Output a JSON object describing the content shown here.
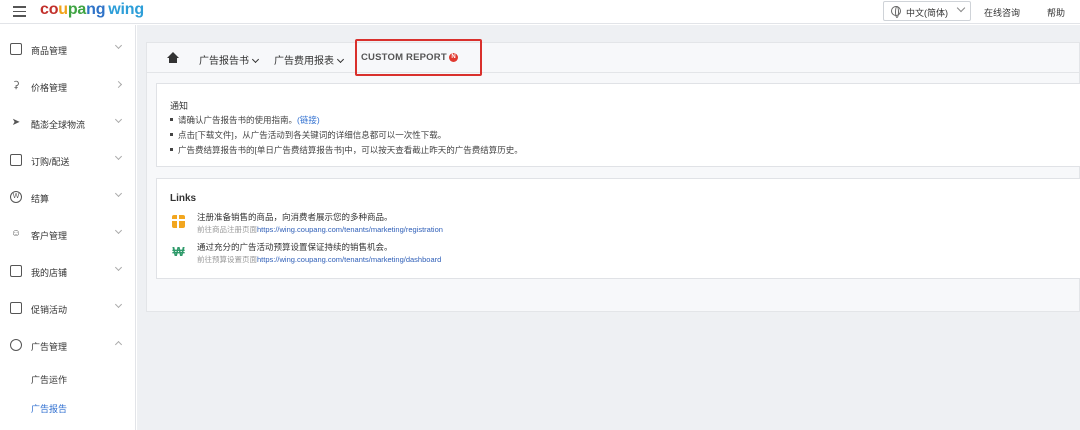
{
  "header": {
    "logo": {
      "c1": "co",
      "c2": "u",
      "c3": "pa",
      "c4": "ng",
      "wing": "wing"
    },
    "language": "中文(简体)",
    "consult_link": "在线咨询",
    "help_link": "帮助"
  },
  "sidebar": {
    "items": [
      {
        "label": "商品管理",
        "icon": "box-icon"
      },
      {
        "label": "价格管理",
        "icon": "medal-icon"
      },
      {
        "label": "酷澎全球物流",
        "icon": "rocket-icon"
      },
      {
        "label": "订购/配送",
        "icon": "truck-icon"
      },
      {
        "label": "结算",
        "icon": "won-coin-icon"
      },
      {
        "label": "客户管理",
        "icon": "smile-icon"
      },
      {
        "label": "我的店铺",
        "icon": "store-icon"
      },
      {
        "label": "促销活动",
        "icon": "coupon-icon"
      },
      {
        "label": "广告管理",
        "icon": "ad-chart-icon"
      }
    ],
    "ad_sub_items": [
      {
        "label": "广告运作",
        "active": false
      },
      {
        "label": "广告报告",
        "active": true
      }
    ]
  },
  "tabs": {
    "report_book": "广告报告书",
    "cost_report": "广告费用报表",
    "custom_report": "CUSTOM REPORT",
    "custom_badge": "N"
  },
  "notice": {
    "title": "通知",
    "lines": [
      {
        "text": "请确认广告报告书的使用指南。",
        "link": "(链接)"
      },
      {
        "text": "点击[下载文件]，从广告活动到各关键词的详细信息都可以一次性下载。",
        "link": ""
      },
      {
        "text": "广告费结算报告书的[单日广告费结算报告书]中，可以按天查看截止昨天的广告费结算历史。",
        "link": ""
      }
    ]
  },
  "links": {
    "title": "Links",
    "rows": [
      {
        "main": "注册准备销售的商品，向消费者展示您的多种商品。",
        "prefix": "前往商品注册页面",
        "url": "https://wing.coupang.com/tenants/marketing/registration",
        "icon": "gift-icon"
      },
      {
        "main": "通过充分的广告活动预算设置保证持续的销售机会。",
        "prefix": "前往预算设置页面",
        "url": "https://wing.coupang.com/tenants/marketing/dashboard",
        "icon": "won-icon"
      }
    ]
  },
  "colors": {
    "accent": "#2f6fd0",
    "highlight_border": "#d9302c",
    "badge": "#e0392f"
  }
}
